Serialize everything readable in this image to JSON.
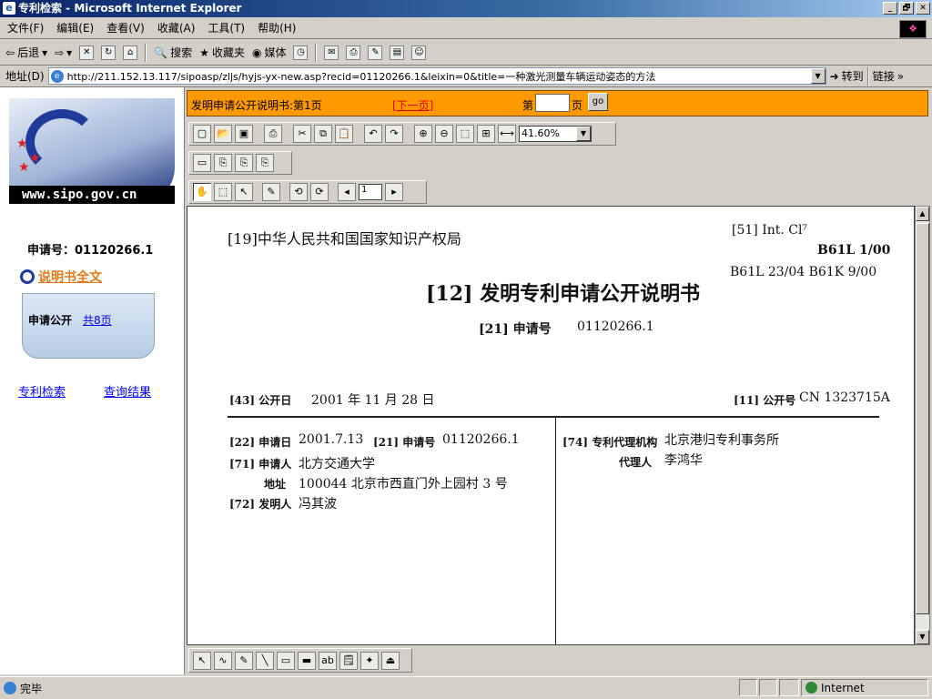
{
  "window": {
    "title": "专利检索 - Microsoft Internet Explorer",
    "btn_min": "_",
    "btn_max": "🗗",
    "btn_close": "✕"
  },
  "menu": [
    "文件(F)",
    "编辑(E)",
    "查看(V)",
    "收藏(A)",
    "工具(T)",
    "帮助(H)"
  ],
  "toolbar": {
    "back": "后退",
    "forward": "",
    "stop": "",
    "refresh": "",
    "home": "",
    "search": "搜索",
    "favorites": "收藏夹",
    "media": "媒体"
  },
  "address": {
    "label": "地址(D)",
    "url": "http://211.152.13.117/sipoasp/zljs/hyjs-yx-new.asp?recid=01120266.1&leixin=0&title=一种激光测量车辆运动姿态的方法",
    "go": "转到",
    "links": "链接"
  },
  "left": {
    "logo_text": "www.sipo.gov.cn",
    "app_number_label": "申请号：01120266.1",
    "fulltext_link": "说明书全文",
    "pub_label": "申请公开",
    "pub_pages_link": "共8页",
    "link_search": "专利检索",
    "link_results": "查询结果"
  },
  "viewer": {
    "header_title": "发明申请公开说明书:第1页",
    "next_link": "[下一页]",
    "page_prefix": "第",
    "page_suffix": "页",
    "go_btn": "go",
    "zoom": "41.60%",
    "page_field": "1"
  },
  "doc": {
    "office": "[19]中华人民共和国国家知识产权局",
    "int_cl": "[51] Int. Cl⁷",
    "cl1": "B61L 1/00",
    "cl2": "B61L 23/04    B61K  9/00",
    "title": "[12] 发明专利申请公开说明书",
    "app_no_label": "[21] 申请号",
    "app_no": "01120266.1",
    "pub_date_label": "[43] 公开日",
    "pub_date": "2001 年 11 月 28 日",
    "pub_no_label": "[11] 公开号",
    "pub_no": "CN 1323715A",
    "filing_label": "[22] 申请日",
    "filing_date": "2001.7.13",
    "app_no2_label": "[21] 申请号",
    "app_no2": "01120266.1",
    "applicant_label": "[71] 申请人",
    "applicant": "北方交通大学",
    "addr_label": "地址",
    "addr": "100044 北京市西直门外上园村 3 号",
    "inventor_label": "[72] 发明人",
    "inventor": "冯其波",
    "agency_label": "[74] 专利代理机构",
    "agency": "北京港归专利事务所",
    "agent_label": "代理人",
    "agent": "李鸿华"
  },
  "status": {
    "text": "完毕",
    "zone": "Internet"
  }
}
